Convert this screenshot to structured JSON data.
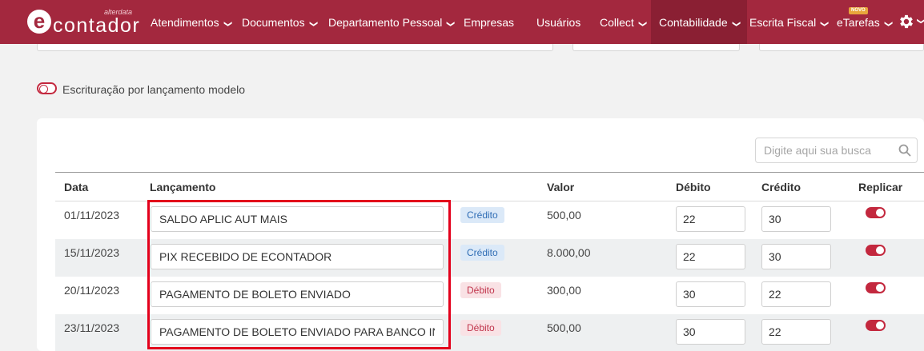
{
  "nav": {
    "logo_sub": "alterdata",
    "logo_text": "contador",
    "items": [
      {
        "label": "Atendimentos",
        "chev": "❯"
      },
      {
        "label": "Documentos",
        "chev": "❯"
      },
      {
        "label": "Departamento Pessoal",
        "chev": "❯"
      },
      {
        "label": "Empresas"
      },
      {
        "label": "Usuários"
      },
      {
        "label": "Collect",
        "chev": "❯"
      },
      {
        "label": "Contabilidade",
        "chev": "❯"
      },
      {
        "label": "Escrita Fiscal",
        "chev": "❯"
      },
      {
        "label": "eTarefas",
        "chev": "❯"
      }
    ],
    "novo_badge": "NOVO",
    "active": "Contabilidade",
    "bg_color": "#a3283e",
    "active_color": "#8a1f33"
  },
  "toggle_modelo": {
    "label": "Escrituração por lançamento modelo",
    "state": "off"
  },
  "search": {
    "placeholder": "Digite aqui sua busca",
    "value": ""
  },
  "table": {
    "headers": {
      "data": "Data",
      "lancamento": "Lançamento",
      "valor": "Valor",
      "debito": "Débito",
      "credito": "Crédito",
      "replicar": "Replicar"
    },
    "rows": [
      {
        "data": "01/11/2023",
        "lancamento": "SALDO APLIC AUT MAIS",
        "tipo": "Crédito",
        "valor": "500,00",
        "debito": "22",
        "credito": "30",
        "replicar": true
      },
      {
        "data": "15/11/2023",
        "lancamento": "PIX RECEBIDO DE ECONTADOR",
        "tipo": "Crédito",
        "valor": "8.000,00",
        "debito": "22",
        "credito": "30",
        "replicar": true
      },
      {
        "data": "20/11/2023",
        "lancamento": "PAGAMENTO DE BOLETO ENVIADO",
        "tipo": "Débito",
        "valor": "300,00",
        "debito": "30",
        "credito": "22",
        "replicar": true
      },
      {
        "data": "23/11/2023",
        "lancamento": "PAGAMENTO DE BOLETO ENVIADO PARA BANCO INTER",
        "tipo": "Débito",
        "valor": "500,00",
        "debito": "30",
        "credito": "22",
        "replicar": true
      }
    ]
  },
  "colors": {
    "accent": "#c3283e",
    "highlight": "#e3001b",
    "credito_bg": "#dbe9f8",
    "debito_bg": "#f9e2e5"
  }
}
